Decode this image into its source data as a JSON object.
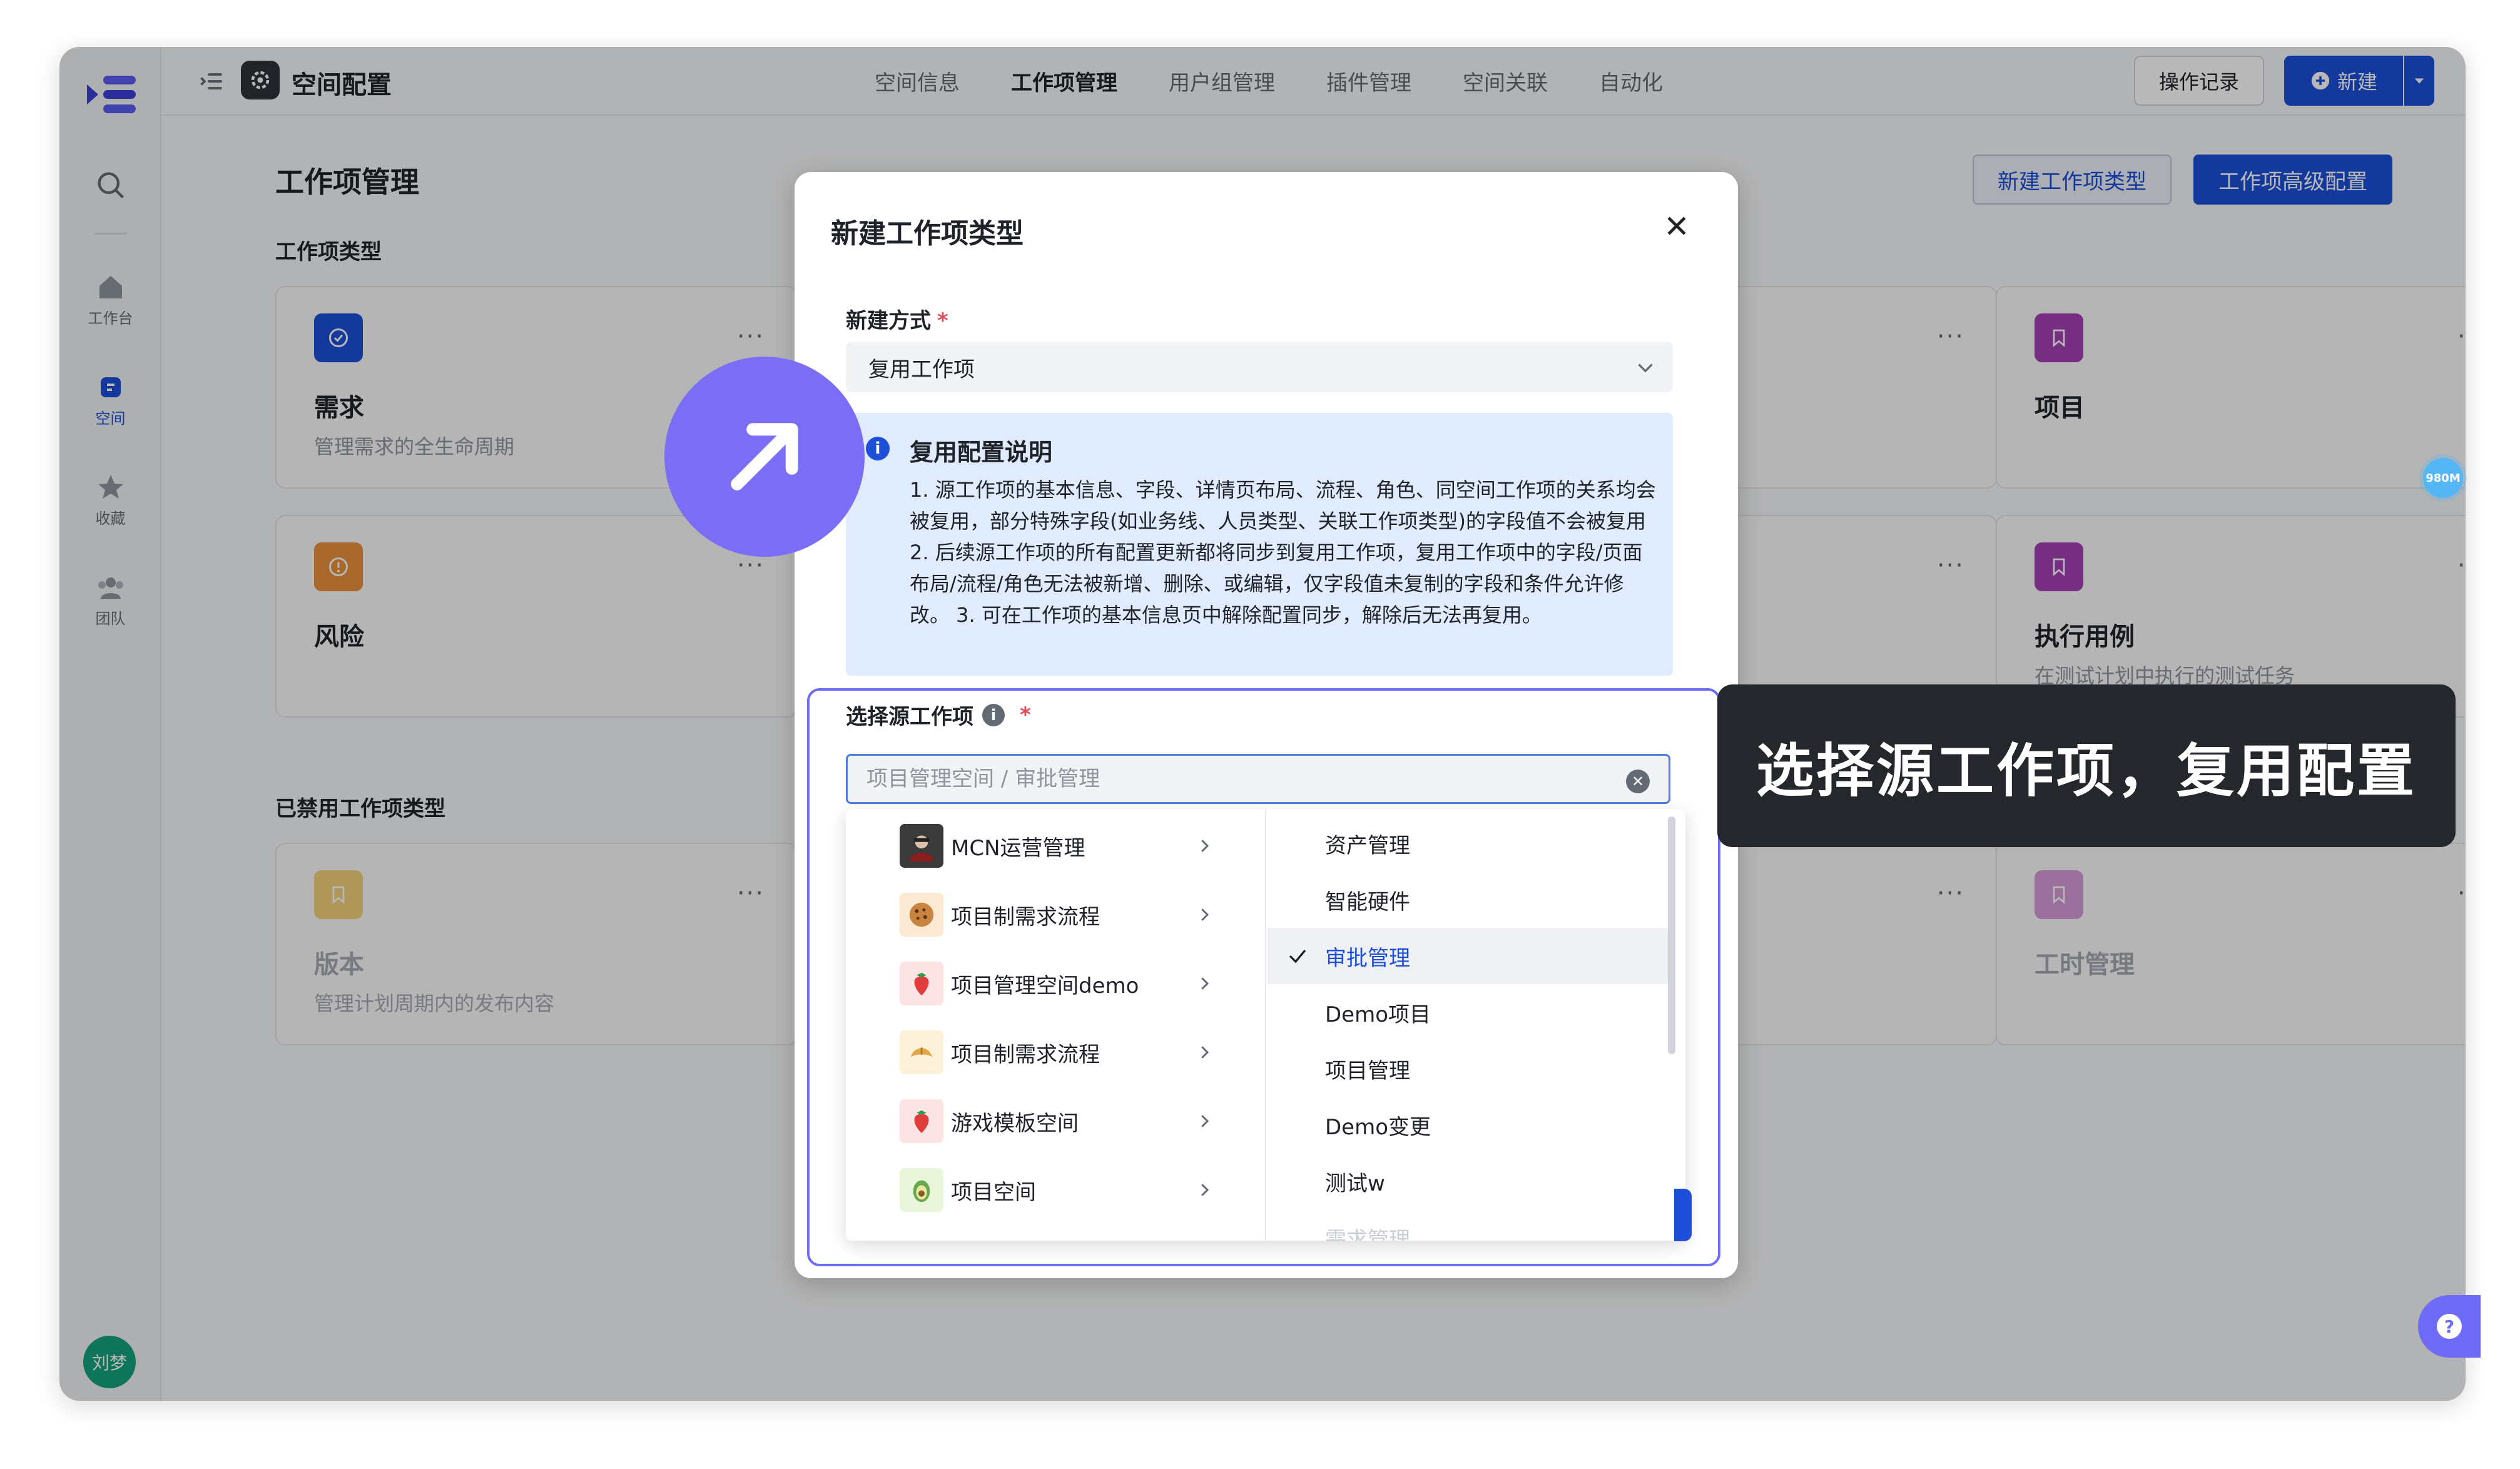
{
  "rail": {
    "items": [
      {
        "label": "工作台",
        "icon": "home-icon"
      },
      {
        "label": "空间",
        "icon": "space-icon"
      },
      {
        "label": "收藏",
        "icon": "star-icon"
      },
      {
        "label": "团队",
        "icon": "team-icon"
      }
    ],
    "avatar": "刘梦"
  },
  "topbar": {
    "title": "空间配置",
    "tabs": [
      "空间信息",
      "工作项管理",
      "用户组管理",
      "插件管理",
      "空间关联",
      "自动化"
    ],
    "active_tab": "工作项管理",
    "log_button": "操作记录",
    "new_button": "新建"
  },
  "main": {
    "title": "工作项管理",
    "section_types": "工作项类型",
    "section_disabled": "已禁用工作项类型",
    "btn_new_type": "新建工作项类型",
    "btn_advanced": "工作项高级配置",
    "cards": [
      {
        "name": "需求",
        "desc": "管理需求的全生命周期",
        "color": "#1d4fd8"
      },
      {
        "name": "风险",
        "desc": "",
        "color": "#e8903a"
      },
      {
        "name": "项目",
        "desc": "",
        "color": "#a43fb5"
      },
      {
        "name": "执行用例",
        "desc": "在测试计划中执行的测试任务",
        "color": "#a43fb5"
      }
    ],
    "disabled_cards": [
      {
        "name": "版本",
        "desc": "管理计划周期内的发布内容",
        "color": "#e8c34a"
      },
      {
        "name": "工时管理",
        "desc": "",
        "color": "#c774cc"
      }
    ],
    "more": "···"
  },
  "modal": {
    "title": "新建工作项类型",
    "method_label": "新建方式",
    "method_value": "复用工作项",
    "info_title": "复用配置说明",
    "info_text": "1. 源工作项的基本信息、字段、详情页布局、流程、角色、同空间工作项的关系均会被复用，部分特殊字段(如业务线、人员类型、关联工作项类型)的字段值不会被复用 2. 后续源工作项的所有配置更新都将同步到复用工作项，复用工作项中的字段/页面布局/流程/角色无法被新增、删除、或编辑，仅字段值未复制的字段和条件允许修改。 3. 可在工作项的基本信息页中解除配置同步，解除后无法再复用。",
    "source_label": "选择源工作项",
    "source_placeholder": "项目管理空间 / 审批管理",
    "required_mark": "*"
  },
  "cascader": {
    "spaces": [
      {
        "label": "MCN运营管理",
        "icon": "avatar-photo-icon"
      },
      {
        "label": "项目制需求流程",
        "icon": "cookie-icon"
      },
      {
        "label": "项目管理空间demo",
        "icon": "strawberry-icon"
      },
      {
        "label": "项目制需求流程",
        "icon": "croissant-icon"
      },
      {
        "label": "游戏模板空间",
        "icon": "strawberry-icon"
      },
      {
        "label": "项目空间",
        "icon": "avocado-icon"
      }
    ],
    "items": [
      "资产管理",
      "智能硬件",
      "审批管理",
      "Demo项目",
      "项目管理",
      "Demo变更",
      "测试w",
      "需求管理"
    ],
    "selected_item": "审批管理"
  },
  "tooltip": "选择源工作项，复用配置",
  "badge": "980M"
}
